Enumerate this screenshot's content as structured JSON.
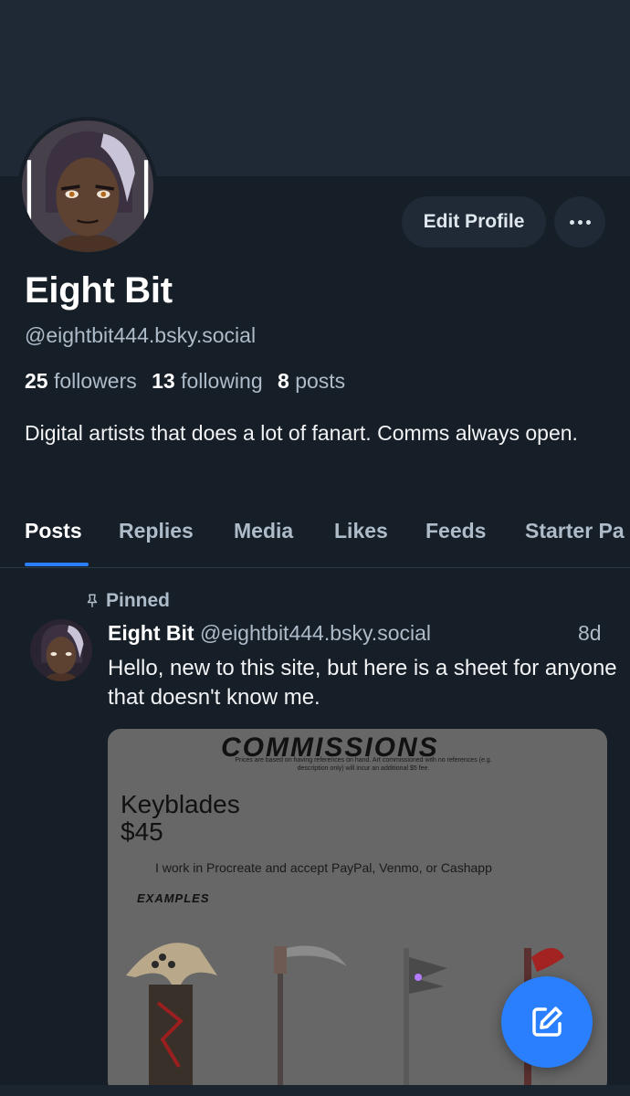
{
  "profile": {
    "display_name": "Eight Bit",
    "handle": "@eightbit444.bsky.social",
    "followers_count": "25",
    "followers_label": "followers",
    "following_count": "13",
    "following_label": "following",
    "posts_count": "8",
    "posts_label": "posts",
    "bio": "Digital artists that does a lot of fanart. Comms always open.",
    "avatar_icon": "avatar-image"
  },
  "actions": {
    "edit_profile_label": "Edit Profile",
    "more_icon": "more-horizontal-icon"
  },
  "tabs": [
    {
      "label": "Posts",
      "active": true
    },
    {
      "label": "Replies",
      "active": false
    },
    {
      "label": "Media",
      "active": false
    },
    {
      "label": "Likes",
      "active": false
    },
    {
      "label": "Feeds",
      "active": false
    },
    {
      "label": "Starter Pa",
      "active": false
    }
  ],
  "pinned_post": {
    "pinned_label": "Pinned",
    "pin_icon": "pin-icon",
    "author_name": "Eight Bit",
    "author_handle": "@eightbit444.bsky.social",
    "time": "8d",
    "text": "Hello, new to this site, but here is a sheet for anyone that doesn't know me.",
    "image": {
      "title": "COMMISSIONS",
      "note": "Prices are based on having references on hand. Art commissioned with no references (e.g. description only) will incur an additional $5 fee.",
      "item_name": "Keyblades",
      "item_price": "$45",
      "tools_line": "I work in Procreate and accept PayPal, Venmo, or Cashapp",
      "examples_label": "EXAMPLES"
    }
  },
  "compose": {
    "icon": "compose-icon"
  },
  "colors": {
    "background": "#161e27",
    "banner": "#1e2935",
    "accent": "#2a7fff",
    "muted_text": "#aebbc9"
  }
}
